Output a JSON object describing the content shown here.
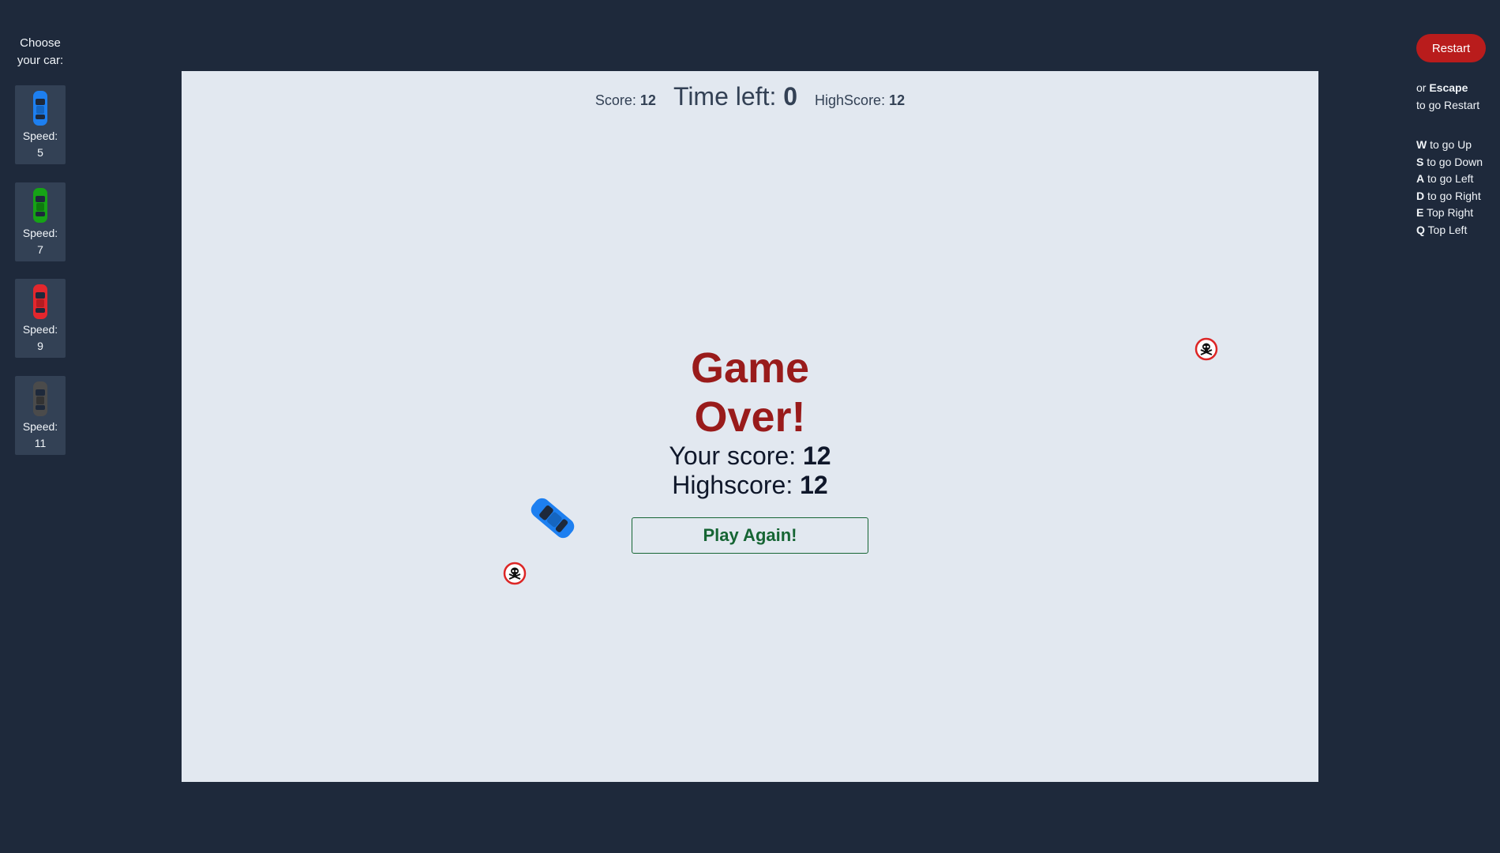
{
  "chooser": {
    "title_line1": "Choose",
    "title_line2": "your car:",
    "cars": [
      {
        "color": "#1d7ff0",
        "speed_label": "Speed:",
        "speed": "5"
      },
      {
        "color": "#16a316",
        "speed_label": "Speed:",
        "speed": "7"
      },
      {
        "color": "#e3272d",
        "speed_label": "Speed:",
        "speed": "9"
      },
      {
        "color": "#4b4b4b",
        "speed_label": "Speed:",
        "speed": "11"
      }
    ]
  },
  "controls": {
    "restart_label": "Restart",
    "escape_prefix": "or ",
    "escape_key": "Escape",
    "escape_suffix": "to go Restart",
    "keys": [
      {
        "key": "W",
        "action": " to go Up"
      },
      {
        "key": "S",
        "action": " to go Down"
      },
      {
        "key": "A",
        "action": " to go Left"
      },
      {
        "key": "D",
        "action": " to go Right"
      },
      {
        "key": "E",
        "action": " Top Right"
      },
      {
        "key": "Q",
        "action": " Top Left"
      }
    ]
  },
  "hud": {
    "score_label": "Score: ",
    "score": "12",
    "time_label": "Time left: ",
    "time": "0",
    "highscore_label": "HighScore: ",
    "highscore": "12"
  },
  "game_over": {
    "title": "Game Over!",
    "your_score_label": "Your score: ",
    "your_score": "12",
    "highscore_label": "Highscore: ",
    "highscore": "12",
    "play_again_label": "Play Again!"
  },
  "icons": {
    "hazard": "skull-crossbones-icon",
    "player_car": "blue-car-icon"
  },
  "colors": {
    "background": "#1e293b",
    "board": "#e2e8f0",
    "restart": "#b91c1c",
    "game_over": "#991b1b",
    "play_again": "#166534"
  }
}
